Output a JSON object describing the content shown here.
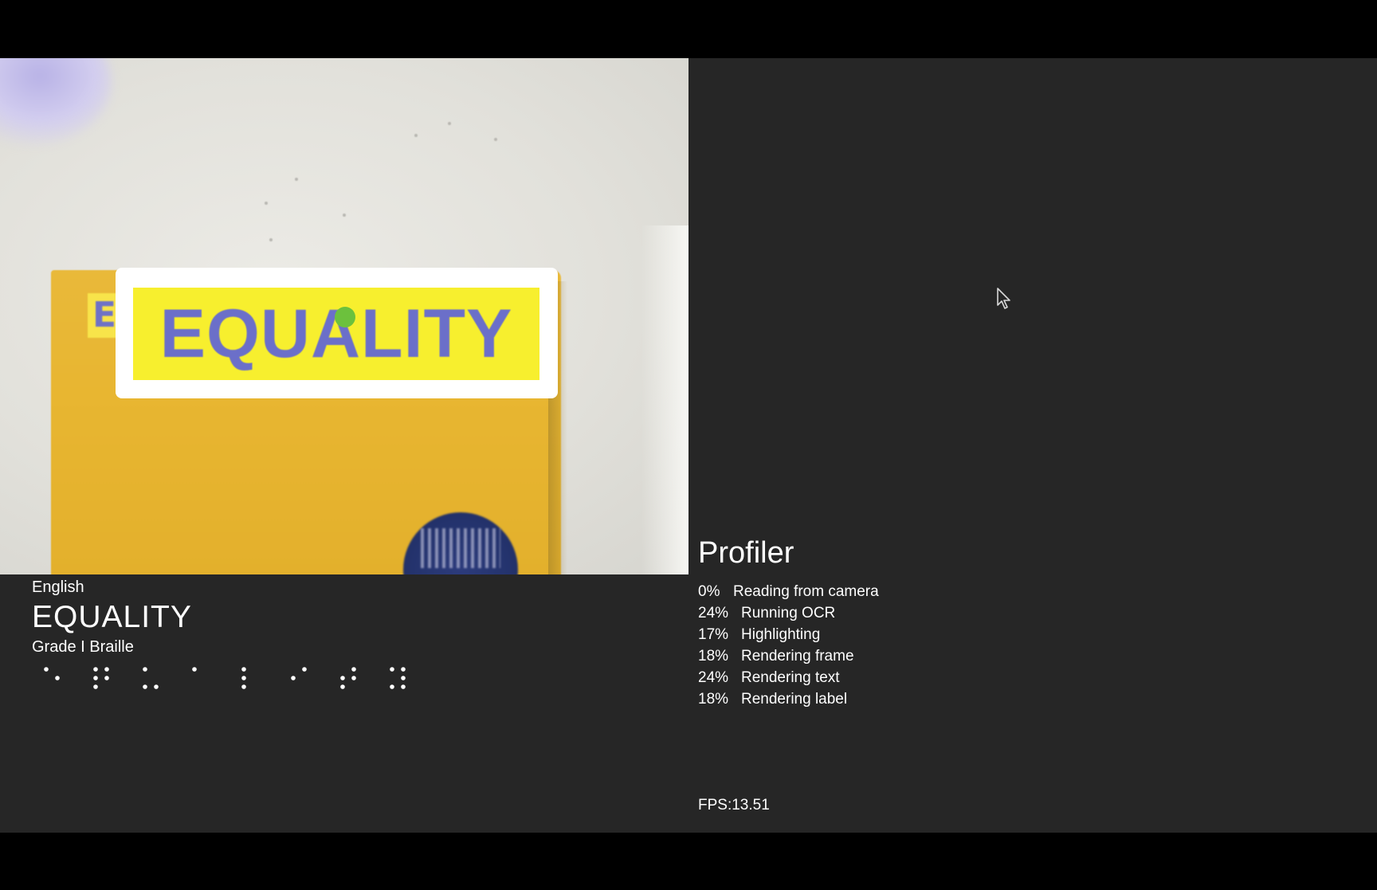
{
  "camera_view": {
    "detected_word_overlay": "EQUALITY",
    "book_letter": "E"
  },
  "recognition": {
    "language": "English",
    "detected_text": "EQUALITY",
    "braille_grade": "Grade I Braille",
    "braille_cells": [
      "⠑",
      "⠟",
      "⠥",
      "⠁",
      "⠇",
      "⠊",
      "⠞",
      "⠽"
    ]
  },
  "profiler": {
    "title": "Profiler",
    "rows": [
      {
        "percent": "0%",
        "label": "Reading from camera"
      },
      {
        "percent": "24%",
        "label": "Running OCR"
      },
      {
        "percent": "17%",
        "label": "Highlighting"
      },
      {
        "percent": "18%",
        "label": "Rendering frame"
      },
      {
        "percent": "24%",
        "label": "Rendering text"
      },
      {
        "percent": "18%",
        "label": "Rendering label"
      }
    ],
    "fps": "FPS:13.51"
  },
  "colors": {
    "background": "#262626",
    "highlight_yellow": "#f7ef2e",
    "highlight_text": "#6b6fc9",
    "focus_dot": "#6cc13d"
  },
  "icons": {
    "cursor": "mouse-pointer-icon",
    "focus": "focus-dot-icon"
  }
}
